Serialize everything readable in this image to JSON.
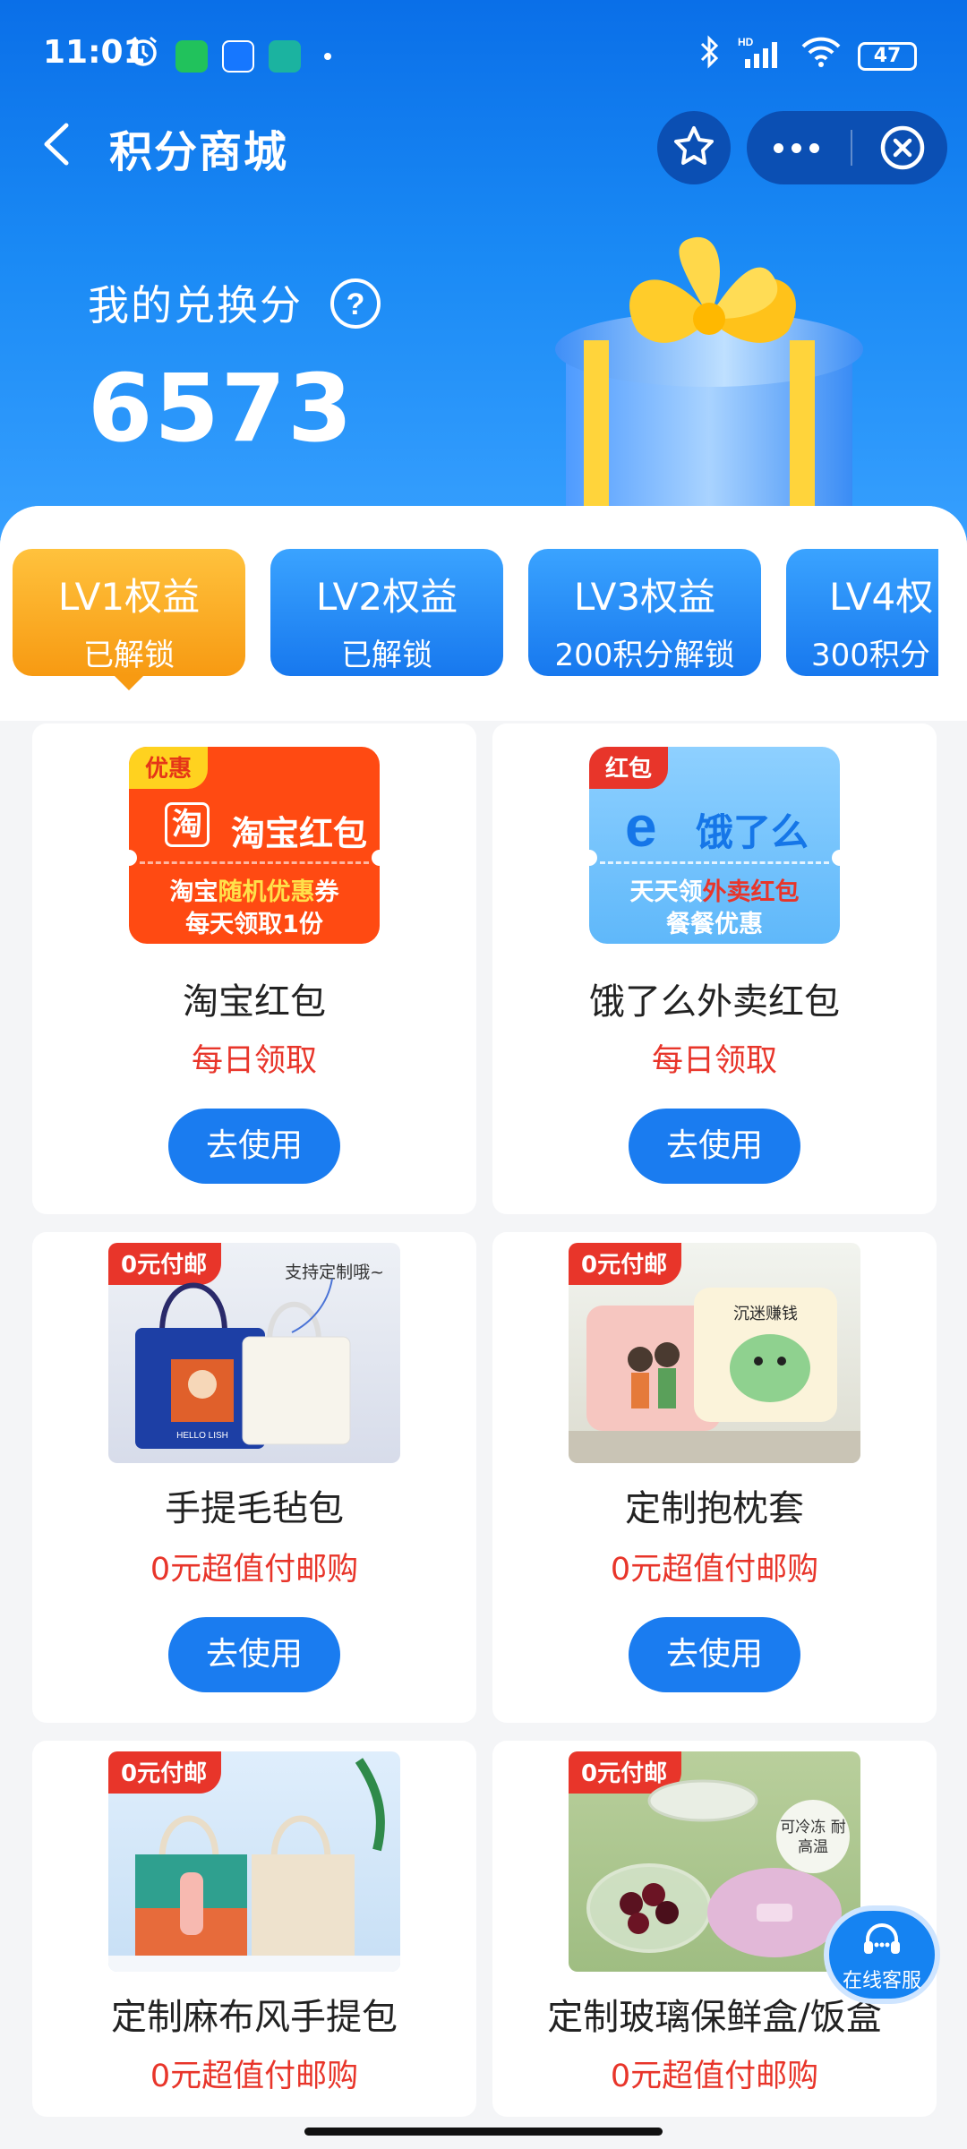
{
  "status_bar": {
    "time": "11:01",
    "battery": "47"
  },
  "nav": {
    "title": "积分商城"
  },
  "points": {
    "label": "我的兑换分",
    "value": "6573"
  },
  "tabs": [
    {
      "title": "LV1权益",
      "sub": "已解锁"
    },
    {
      "title": "LV2权益",
      "sub": "已解锁"
    },
    {
      "title": "LV3权益",
      "sub": "200积分解锁"
    },
    {
      "title": "LV4权",
      "sub": "300积分"
    }
  ],
  "products": [
    {
      "title": "淘宝红包",
      "subtitle": "每日领取",
      "button": "去使用",
      "coupon": {
        "tag": "优惠",
        "logo_char": "淘",
        "name": "淘宝红包",
        "line1_a": "淘宝",
        "line1_b": "随机优惠",
        "line1_c": "券",
        "line2": "每天领取1份"
      }
    },
    {
      "title": "饿了么外卖红包",
      "subtitle": "每日领取",
      "button": "去使用",
      "coupon": {
        "tag": "红包",
        "logo_char": "e",
        "name": "饿了么",
        "line1_a": "天天领",
        "line1_b": "外卖红包",
        "line2": "餐餐优惠"
      }
    },
    {
      "title": "手提毛毡包",
      "subtitle": "0元超值付邮购",
      "button": "去使用",
      "tag": "0元付邮",
      "note": "支持定制哦~",
      "bag_text": "HELLO LISH"
    },
    {
      "title": "定制抱枕套",
      "subtitle": "0元超值付邮购",
      "button": "去使用",
      "tag": "0元付邮",
      "pillow_text": "沉迷赚钱"
    },
    {
      "title": "定制麻布风手提包",
      "subtitle": "0元超值付邮购",
      "tag": "0元付邮"
    },
    {
      "title": "定制玻璃保鲜盒/饭盒",
      "subtitle": "0元超值付邮购",
      "tag": "0元付邮",
      "note": "可冷冻 耐高温"
    }
  ],
  "float_service": {
    "label": "在线客服"
  },
  "colors": {
    "primary": "#1a7cf0",
    "accent_red": "#e8352a",
    "active_tab": "#f79a12"
  }
}
